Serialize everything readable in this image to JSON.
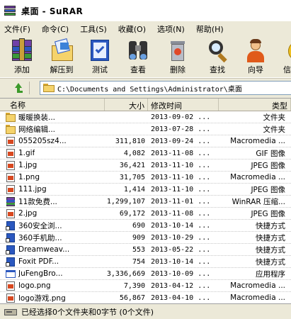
{
  "window": {
    "title": "桌面 - SuRAR"
  },
  "menu": [
    "文件(F)",
    "命令(C)",
    "工具(S)",
    "收藏(O)",
    "选项(N)",
    "帮助(H)"
  ],
  "toolbar": {
    "add": "添加",
    "extract": "解压到",
    "test": "测试",
    "view": "查看",
    "delete": "删除",
    "find": "查找",
    "wizard": "向导",
    "info": "信"
  },
  "address": {
    "path": "C:\\Documents and Settings\\Administrator\\桌面"
  },
  "columns": {
    "name": "名称",
    "size": "大小",
    "modified": "修改时间",
    "type": "类型"
  },
  "files": [
    {
      "name": "暖暖换装...",
      "size": "",
      "date": "2013-09-02 ...",
      "type": "文件夹",
      "icon": "folder"
    },
    {
      "name": "网络编辑...",
      "size": "",
      "date": "2013-07-28 ...",
      "type": "文件夹",
      "icon": "folder"
    },
    {
      "name": "055205sz4...",
      "size": "311,810",
      "date": "2013-09-24 ...",
      "type": "Macromedia ...",
      "icon": "image"
    },
    {
      "name": "1.gif",
      "size": "4,082",
      "date": "2013-11-08 ...",
      "type": "GIF 图像",
      "icon": "image"
    },
    {
      "name": "1.jpg",
      "size": "36,421",
      "date": "2013-11-10 ...",
      "type": "JPEG 图像",
      "icon": "image"
    },
    {
      "name": "1.png",
      "size": "31,705",
      "date": "2013-11-10 ...",
      "type": "Macromedia ...",
      "icon": "image"
    },
    {
      "name": "111.jpg",
      "size": "1,414",
      "date": "2013-11-10 ...",
      "type": "JPEG 图像",
      "icon": "image"
    },
    {
      "name": "11款免费...",
      "size": "1,299,107",
      "date": "2013-11-01 ...",
      "type": "WinRAR 压缩...",
      "icon": "archive"
    },
    {
      "name": "2.jpg",
      "size": "69,172",
      "date": "2013-11-08 ...",
      "type": "JPEG 图像",
      "icon": "image"
    },
    {
      "name": "360安全浏...",
      "size": "690",
      "date": "2013-10-14 ...",
      "type": "快捷方式",
      "icon": "shortcut"
    },
    {
      "name": "360手机助...",
      "size": "909",
      "date": "2013-10-29 ...",
      "type": "快捷方式",
      "icon": "shortcut"
    },
    {
      "name": "Dreamweav...",
      "size": "553",
      "date": "2013-05-22 ...",
      "type": "快捷方式",
      "icon": "shortcut"
    },
    {
      "name": "Foxit PDF...",
      "size": "754",
      "date": "2013-10-14 ...",
      "type": "快捷方式",
      "icon": "shortcut"
    },
    {
      "name": "JuFengBro...",
      "size": "3,336,669",
      "date": "2013-10-09 ...",
      "type": "应用程序",
      "icon": "app"
    },
    {
      "name": "logo.png",
      "size": "7,390",
      "date": "2013-04-12 ...",
      "type": "Macromedia ...",
      "icon": "image"
    },
    {
      "name": "logo游戏.png",
      "size": "56,867",
      "date": "2013-04-10 ...",
      "type": "Macromedia ...",
      "icon": "image"
    }
  ],
  "status": {
    "text": "已经选择0个文件夹和0字节 (0个文件)"
  },
  "colors": {
    "folder": "#f5d36b",
    "accent_blue": "#2b58c0",
    "window_bg": "#ece9d8"
  }
}
